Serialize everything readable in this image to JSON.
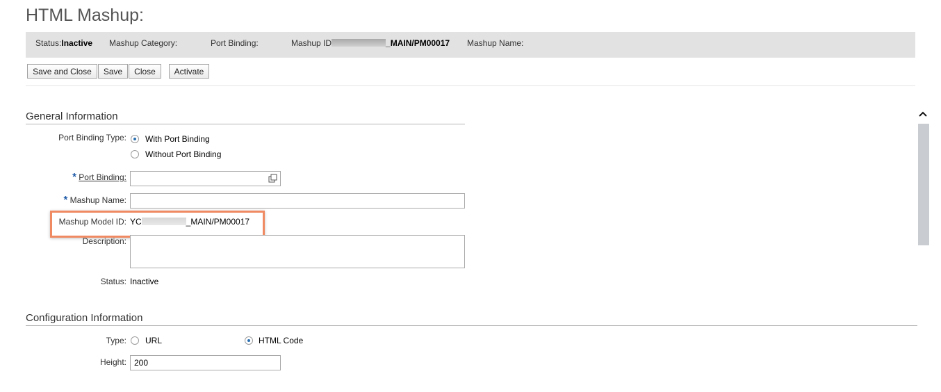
{
  "page": {
    "title": "HTML Mashup:"
  },
  "status_bar": {
    "status_label": "Status:",
    "status_value": "Inactive",
    "category_label": "Mashup Category:",
    "port_binding_label": "Port Binding:",
    "mashup_id_label": "Mashup ID",
    "mashup_id_value_suffix": "_MAIN/PM00017",
    "mashup_name_label": "Mashup Name:"
  },
  "toolbar": {
    "save_close": "Save and Close",
    "save": "Save",
    "close": "Close",
    "activate": "Activate"
  },
  "general": {
    "title": "General Information",
    "port_binding_type_label": "Port Binding Type:",
    "option_with": "With Port Binding",
    "option_without": "Without Port Binding",
    "selected_option": "With Port Binding",
    "port_binding_label": "Port Binding:",
    "port_binding_value": "",
    "mashup_name_label": "Mashup Name:",
    "mashup_name_value": "",
    "model_id_label": "Mashup Model ID:",
    "model_id_prefix": "YC",
    "model_id_suffix": "_MAIN/PM00017",
    "description_label": "Description:",
    "description_value": "",
    "status_label": "Status:",
    "status_value": "Inactive"
  },
  "config": {
    "title": "Configuration Information",
    "type_label": "Type:",
    "option_url": "URL",
    "option_html": "HTML Code",
    "selected_option": "HTML Code",
    "height_label": "Height:",
    "height_value": "200"
  },
  "colors": {
    "accent": "#2a6fb0",
    "required": "#1e5aa7",
    "highlight": "#ef8a62",
    "status_bar_bg": "#e2e2e2"
  },
  "icons": {
    "value_help": "value-help-icon",
    "scroll_up": "chevron-up-icon"
  }
}
